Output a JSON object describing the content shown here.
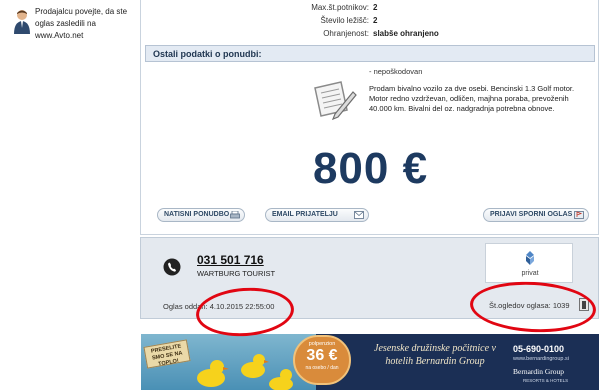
{
  "sidebar": {
    "tip_text": "Prodajalcu povejte, da ste oglas zasledili na www.Avto.net"
  },
  "specs": [
    {
      "label": "Max.št.potnikov:",
      "value": "2"
    },
    {
      "label": "Število ležišč:",
      "value": "2"
    },
    {
      "label": "Ohranjenost:",
      "value": "slabše ohranjeno"
    }
  ],
  "other_section": {
    "title": "Ostali podatki o ponudbi:",
    "feature": "- nepoškodovan",
    "description": "Prodam bivalno vozilo za dve osebi. Bencinski 1.3 Golf motor. Motor redno vzdrževan, odličen, majhna poraba, prevoženih 40.000 km. Bivalni del oz. nadgradnja potrebna obnove."
  },
  "price": "800 €",
  "actions": {
    "print": "NATISNI PONUDBO",
    "email": "EMAIL PRIJATELJU",
    "report": "PRIJAVI SPORNI OGLAS"
  },
  "contact": {
    "phone": "031 501 716",
    "name": "WARTBURG TOURIST",
    "seller_type": "privat",
    "posted_label": "Oglas oddan:",
    "posted_value": "4.10.2015 22:55:00",
    "views_label": "Št.ogledov oglasa:",
    "views_value": "1039"
  },
  "banner": {
    "sign": "PRESELITE SMO SE NA TOPLO!",
    "offer_top": "polpenzion",
    "offer_price": "36 €",
    "offer_bottom": "na osebo / dan",
    "slogan": "Jesenske družinske počitnice v hotelih Bernardin Group",
    "phone": "05-690-0100",
    "url": "www.bernardingroup.si",
    "brand": "Bernardin Group",
    "brand_sub": "RESORTS & HOTELS"
  },
  "colors": {
    "price": "#1d3a60",
    "section_bg": "#e3eaf3",
    "contact_bg": "#e4e9ef",
    "highlight": "#e10612"
  }
}
